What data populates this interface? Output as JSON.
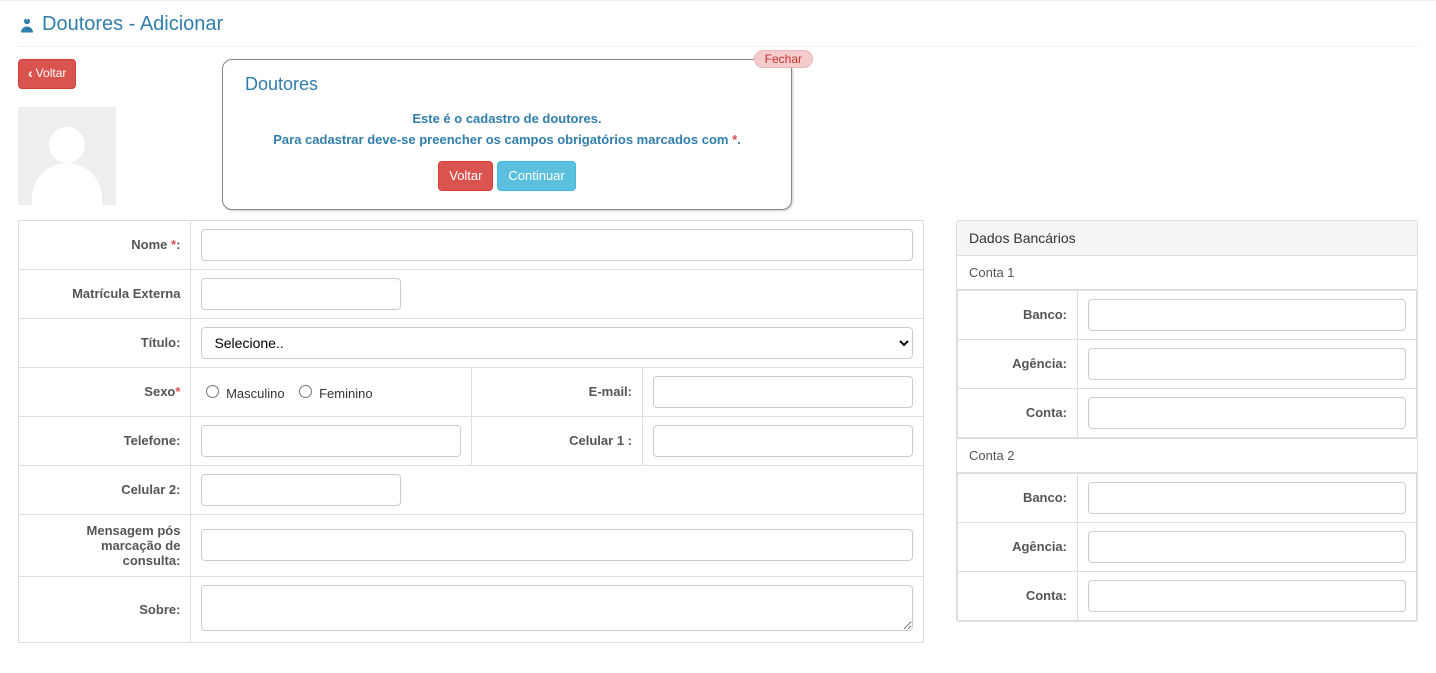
{
  "header": {
    "title": "Doutores - Adicionar",
    "back_label": "Voltar"
  },
  "dialog": {
    "title": "Doutores",
    "line1": "Este é o cadastro de doutores.",
    "line2_pre": "Para cadastrar deve-se preencher os campos obrigatórios marcados com ",
    "line2_star": "*",
    "line2_post": ".",
    "btn_back": "Voltar",
    "btn_continue": "Continuar",
    "close": "Fechar"
  },
  "form": {
    "nome_label": "Nome ",
    "req": "*",
    "nome_colon": ":",
    "matricula_label": "Matrícula Externa",
    "titulo_label": "Título:",
    "titulo_placeholder": "Selecione..",
    "sexo_label": "Sexo",
    "masc_label": "Masculino",
    "fem_label": "Feminino",
    "email_label": "E-mail:",
    "tel_label": "Telefone:",
    "cel1_label": "Celular 1 :",
    "cel2_label": "Celular 2:",
    "msg_label_l1": "Mensagem pós marcação de",
    "msg_label_l2": "consulta:",
    "sobre_label": "Sobre:"
  },
  "bank": {
    "panel_title": "Dados Bancários",
    "conta1": "Conta 1",
    "conta2": "Conta 2",
    "banco_label": "Banco:",
    "agencia_label": "Agência:",
    "conta_label": "Conta:"
  }
}
